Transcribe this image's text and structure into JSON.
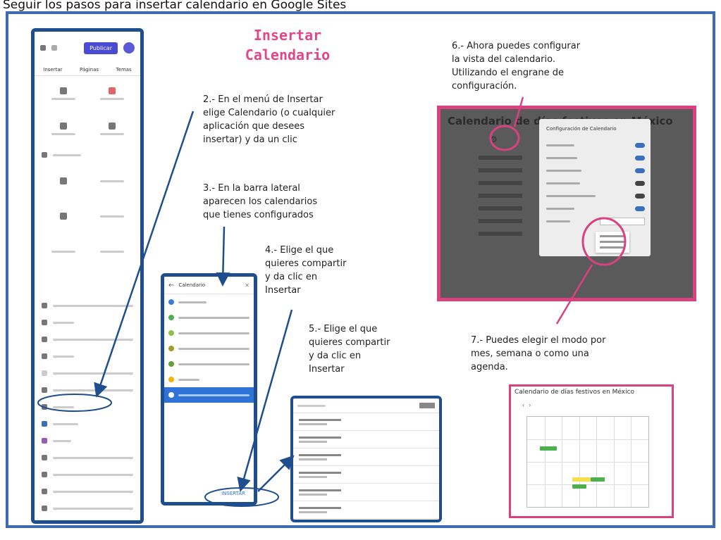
{
  "header_text": "Seguir los pasos para insertar calendario en Google Sites",
  "title_line1": "Insertar",
  "title_line2": "Calendario",
  "steps": {
    "step2": [
      "2.- En el menú de Insertar",
      "elige Calendario (o cualquier",
      "aplicación que desees",
      "insertar) y da un clic"
    ],
    "step3": [
      "3.- En la barra lateral",
      "aparecen los calendarios",
      "que tienes configurados"
    ],
    "step4": [
      "4.- Elige el que",
      "quieres compartir",
      "y da clic en",
      "Insertar"
    ],
    "step5": [
      "5.- Elige el que",
      "quieres compartir",
      "y da clic en",
      "Insertar"
    ],
    "step6": [
      "6.- Ahora puedes configurar",
      "la vista del calendario.",
      "Utilizando el engrane de",
      "configuración."
    ],
    "step7": [
      "7.- Puedes elegir el modo por",
      "mes, semana o como una",
      "agenda."
    ]
  },
  "sidebar_screenshot": {
    "publish_label": "Publicar",
    "tabs": [
      "Insertar",
      "Páginas",
      "Temas"
    ]
  },
  "calendar_list": {
    "header": "Calendario",
    "insert_label": "INSERTAR"
  },
  "settings": {
    "dark_title": "Calendario de días festivos en México",
    "dialog_title": "Configuración de Calendario"
  },
  "month_preview": {
    "title": "Calendario de días festivos en México"
  },
  "colors": {
    "accent_pink": "#e0478a",
    "accent_blue": "#1f4e8f",
    "frame_blue": "#3d6bb3",
    "selection_blue": "#2f73d8"
  }
}
